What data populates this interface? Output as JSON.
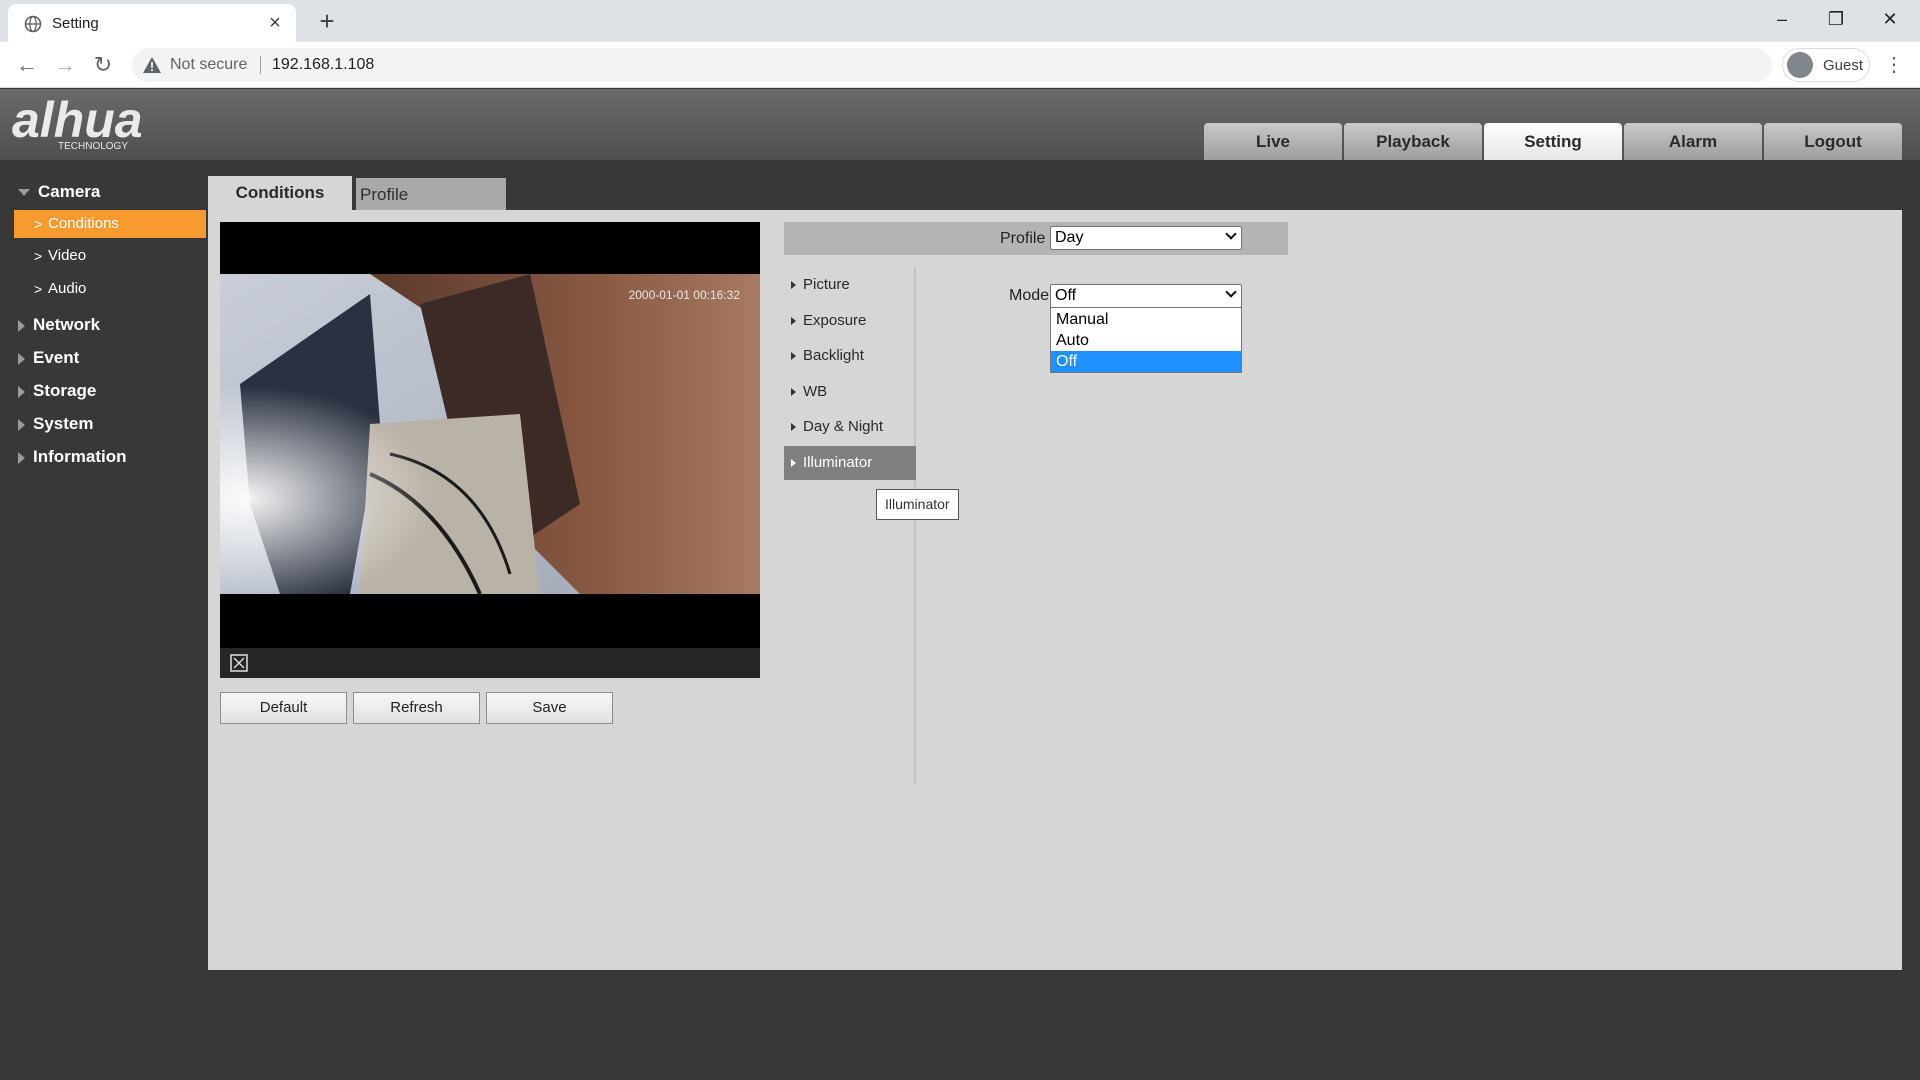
{
  "browser": {
    "tab_title": "Setting",
    "url_warning": "Not secure",
    "url": "192.168.1.108",
    "profile_label": "Guest"
  },
  "app": {
    "logo_text": "alhua",
    "logo_subtext": "TECHNOLOGY",
    "nav": [
      {
        "label": "Live"
      },
      {
        "label": "Playback"
      },
      {
        "label": "Setting",
        "active": true
      },
      {
        "label": "Alarm"
      },
      {
        "label": "Logout"
      }
    ]
  },
  "sidebar": {
    "camera": "Camera",
    "camera_items": [
      "Conditions",
      "Video",
      "Audio"
    ],
    "active_item": "Conditions",
    "groups": [
      "Network",
      "Event",
      "Storage",
      "System",
      "Information"
    ]
  },
  "content": {
    "tabs": [
      "Conditions",
      "Profile Management"
    ],
    "timestamp": "2000-01-01 00:16:32",
    "buttons": [
      "Default",
      "Refresh",
      "Save"
    ],
    "profile_label": "Profile",
    "profile_value": "Day",
    "subnav": [
      "Picture",
      "Exposure",
      "Backlight",
      "WB",
      "Day & Night",
      "Illuminator"
    ],
    "active_subnav": "Illuminator",
    "tooltip": "Illuminator",
    "mode_label": "Mode",
    "mode_value": "Off",
    "mode_options": [
      "Manual",
      "Auto",
      "Off"
    ],
    "mode_selected": "Off"
  },
  "colors": {
    "accent": "#f79a2f",
    "selection": "#1e90ff",
    "background": "#383838",
    "panel": "#d6d6d6"
  }
}
